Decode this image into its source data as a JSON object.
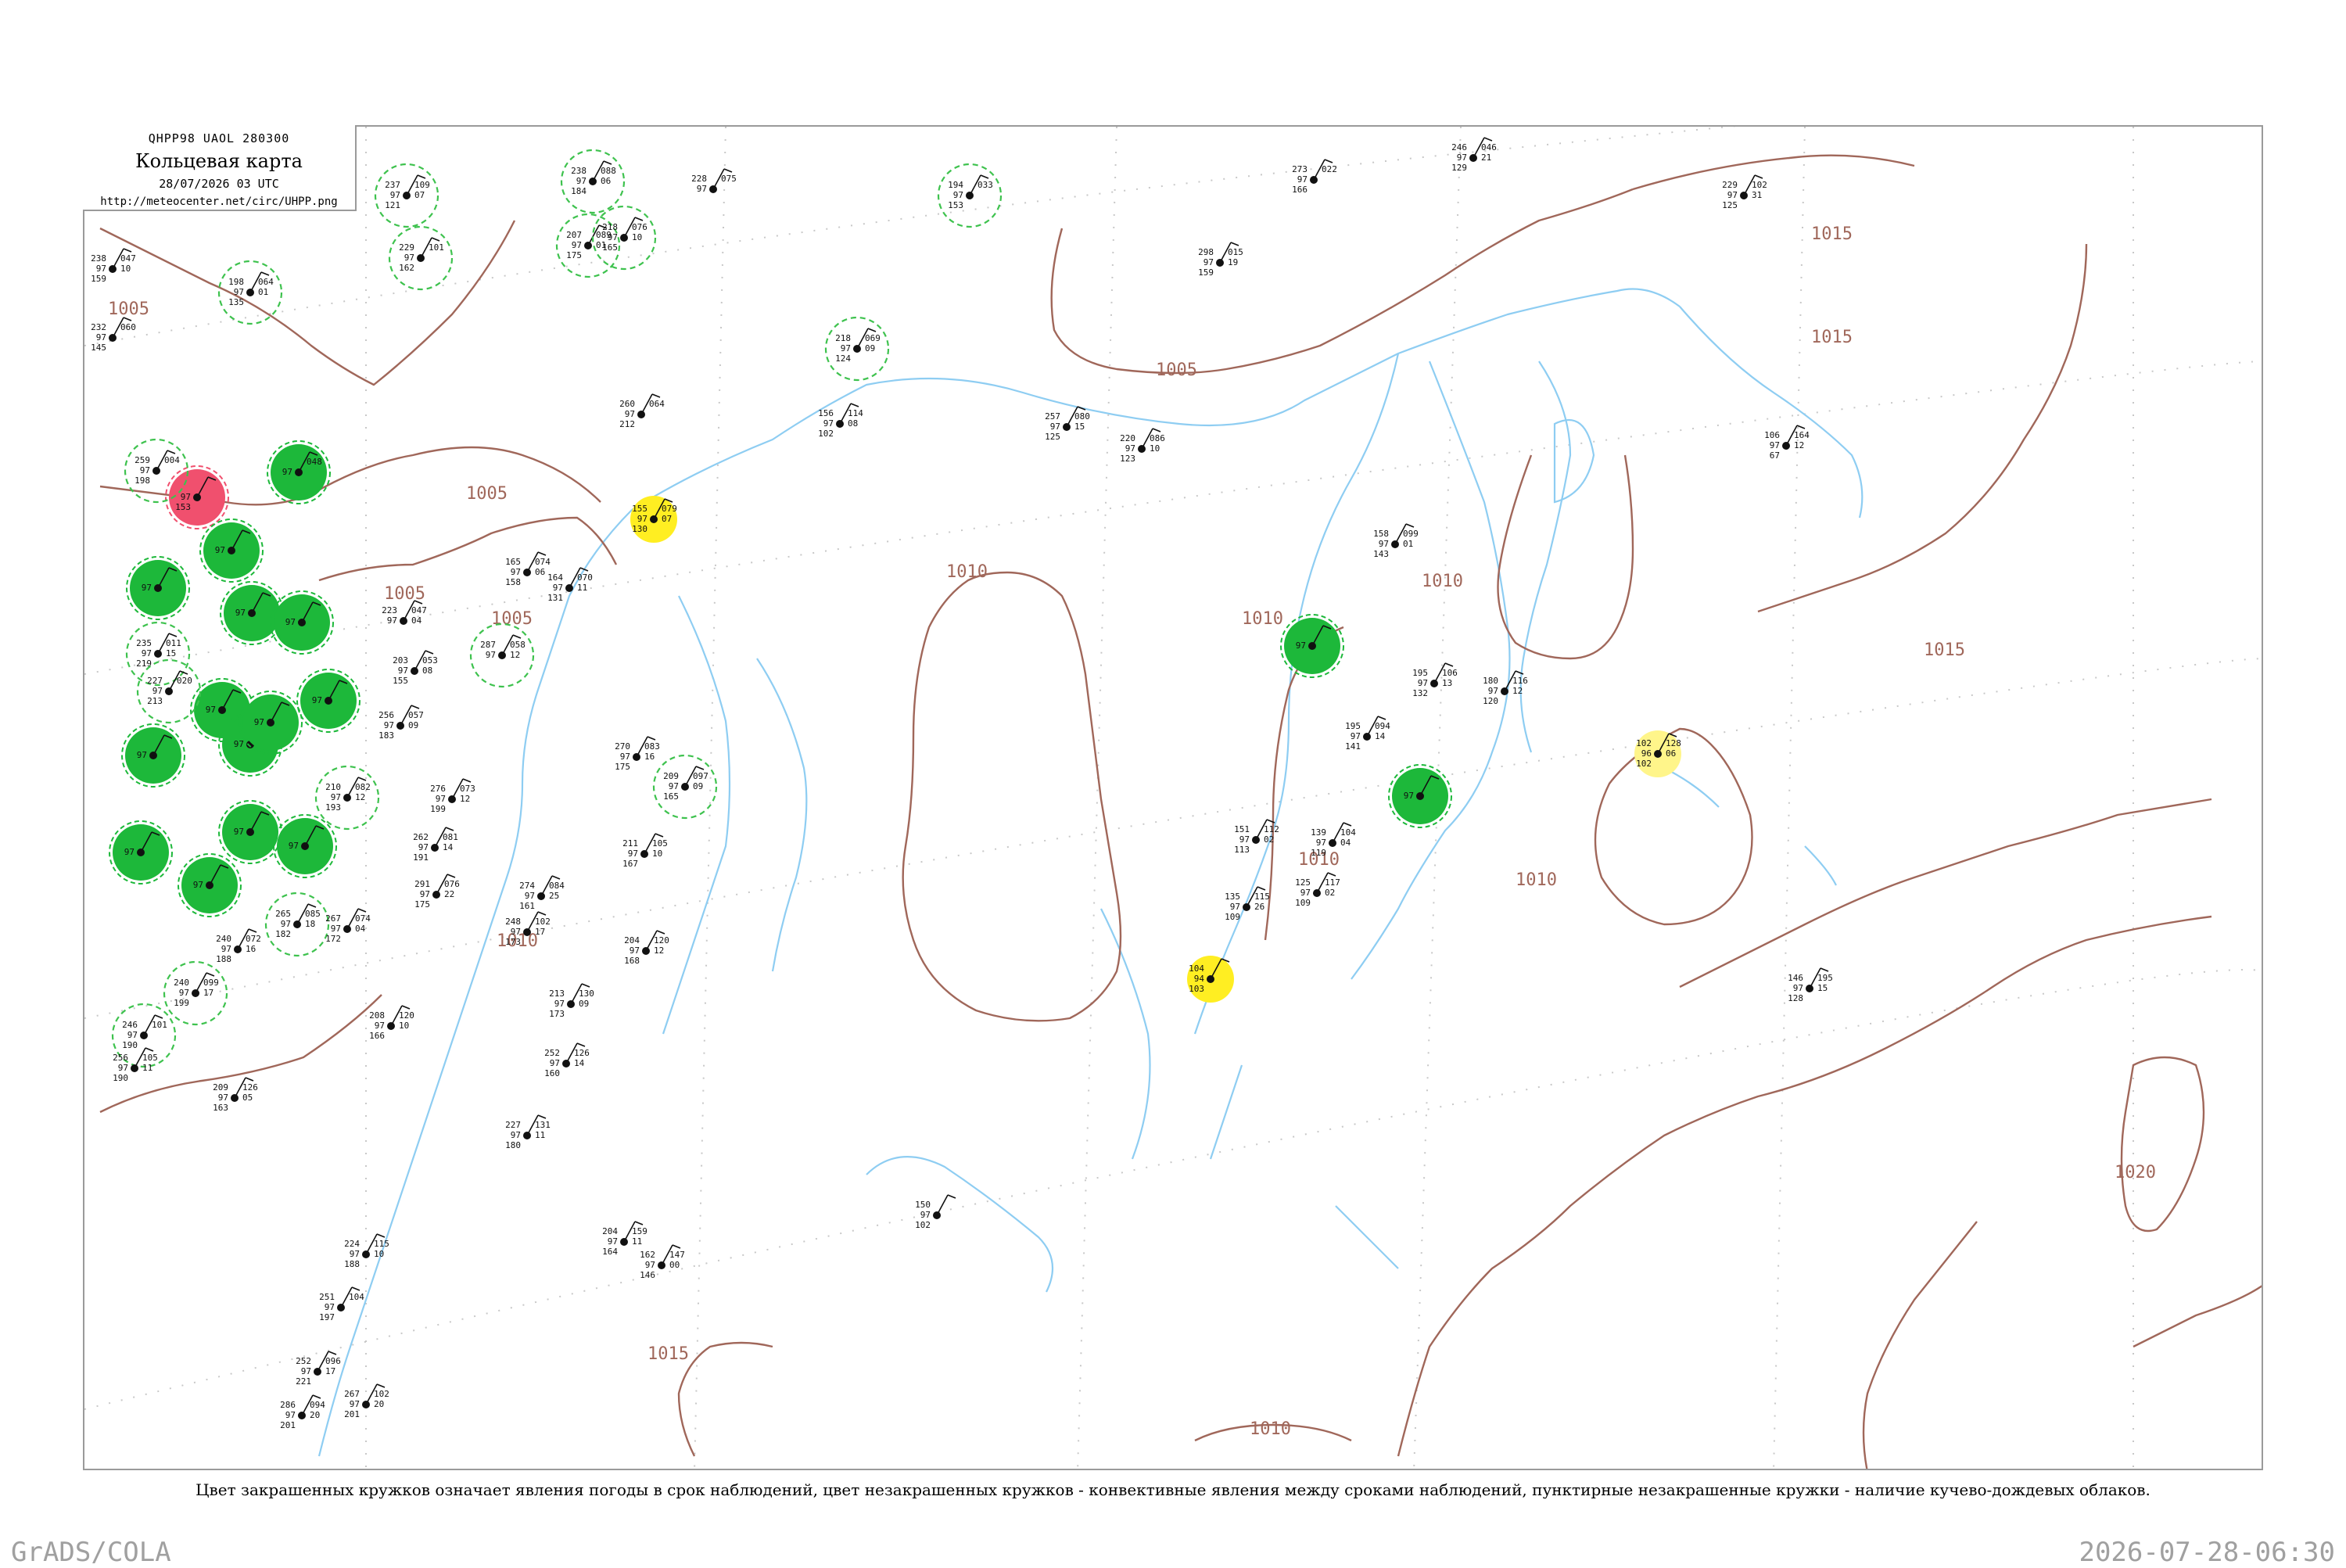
{
  "header": {
    "code": "QHPP98 UAOL 280300",
    "title": "Кольцевая карта",
    "date": "28/07/2026 03 UTC",
    "url": "http://meteocenter.net/circ/UHPP.png"
  },
  "legend": "Цвет закрашенных кружков означает явления погоды в срок наблюдений, цвет незакрашенных кружков - конвективные явления между сроками наблюдений, пунктирные незакрашенные кружки - наличие кучево-дождевых облаков.",
  "footer": {
    "left": "GrADS/COLA",
    "right": "2026-07-28-06:30"
  },
  "colors": {
    "isobar": "#a0675a",
    "coast": "#8ecdf2",
    "green_fill": "#1db83a",
    "green_dash": "#3ec24e",
    "red_fill": "#f0506e",
    "yellow_fill": "#ffee22",
    "light_yellow_fill": "#fff58a",
    "grid": "#c8c8c8"
  },
  "isobars": [
    {
      "label": "1005"
    },
    {
      "label": "1005"
    },
    {
      "label": "1005"
    },
    {
      "label": "1005"
    },
    {
      "label": "1005"
    },
    {
      "label": "1010"
    },
    {
      "label": "1010"
    },
    {
      "label": "1010"
    },
    {
      "label": "1010"
    },
    {
      "label": "1010"
    },
    {
      "label": "1010"
    },
    {
      "label": "1010"
    },
    {
      "label": "1015"
    },
    {
      "label": "1015"
    },
    {
      "label": "1015"
    },
    {
      "label": "1015"
    },
    {
      "label": "1020"
    }
  ],
  "stations": [
    {
      "id": "s1",
      "marker": "red",
      "vals": [
        "",
        "97",
        "153"
      ],
      "right": [
        "",
        "",
        ""
      ]
    },
    {
      "id": "s2",
      "marker": "green",
      "vals": [
        "",
        "97",
        ""
      ],
      "right": [
        "048",
        "",
        ""
      ]
    },
    {
      "id": "s3",
      "marker": "green",
      "vals": [
        "",
        "97",
        ""
      ],
      "right": [
        "",
        "",
        ""
      ]
    },
    {
      "id": "s4",
      "marker": "green",
      "vals": [
        "",
        "97",
        ""
      ],
      "right": [
        "",
        "",
        ""
      ]
    },
    {
      "id": "s5",
      "marker": "green",
      "vals": [
        "",
        "97",
        ""
      ],
      "right": [
        "",
        "",
        ""
      ]
    },
    {
      "id": "s6",
      "marker": "green",
      "vals": [
        "",
        "97",
        ""
      ],
      "right": [
        "",
        "",
        ""
      ]
    },
    {
      "id": "s7",
      "marker": "green",
      "vals": [
        "",
        "97",
        ""
      ],
      "right": [
        "",
        "",
        ""
      ]
    },
    {
      "id": "s8",
      "marker": "green",
      "vals": [
        "",
        "97",
        ""
      ],
      "right": [
        "",
        "",
        ""
      ]
    },
    {
      "id": "s9",
      "marker": "green",
      "vals": [
        "",
        "97",
        ""
      ],
      "right": [
        "",
        "",
        ""
      ]
    },
    {
      "id": "s10",
      "marker": "green",
      "vals": [
        "",
        "97",
        ""
      ],
      "right": [
        "",
        "",
        ""
      ]
    },
    {
      "id": "s11",
      "marker": "green",
      "vals": [
        "",
        "97",
        ""
      ],
      "right": [
        "",
        "",
        ""
      ]
    },
    {
      "id": "s12",
      "marker": "green",
      "vals": [
        "",
        "97",
        ""
      ],
      "right": [
        "",
        "",
        ""
      ]
    },
    {
      "id": "s13",
      "marker": "green",
      "vals": [
        "",
        "97",
        ""
      ],
      "right": [
        "",
        "",
        ""
      ]
    },
    {
      "id": "s14",
      "marker": "green",
      "vals": [
        "",
        "97",
        ""
      ],
      "right": [
        "",
        "",
        ""
      ]
    },
    {
      "id": "s15",
      "marker": "green",
      "vals": [
        "",
        "97",
        ""
      ],
      "right": [
        "",
        "",
        ""
      ]
    },
    {
      "id": "s16",
      "marker": "green",
      "vals": [
        "",
        "97",
        ""
      ],
      "right": [
        "",
        "",
        ""
      ]
    },
    {
      "id": "s17",
      "marker": "green",
      "vals": [
        "",
        "97",
        ""
      ],
      "right": [
        "",
        "",
        ""
      ]
    },
    {
      "id": "s18",
      "marker": "yellow",
      "vals": [
        "155",
        "97",
        "130"
      ],
      "right": [
        "079",
        "07",
        ""
      ]
    },
    {
      "id": "s19",
      "marker": "yellow",
      "vals": [
        "104",
        "94",
        "103"
      ],
      "right": [
        "",
        "",
        ""
      ]
    },
    {
      "id": "s20",
      "marker": "light_yellow",
      "vals": [
        "102",
        "96",
        "102"
      ],
      "right": [
        "128",
        "06",
        ""
      ]
    },
    {
      "id": "s21",
      "marker": "green-dash",
      "vals": [
        "237",
        "97",
        "121"
      ],
      "right": [
        "109",
        "07",
        ""
      ]
    },
    {
      "id": "s22",
      "marker": "green-dash",
      "vals": [
        "229",
        "97",
        "162"
      ],
      "right": [
        "101",
        "",
        ""
      ]
    },
    {
      "id": "s23",
      "marker": "green-dash",
      "vals": [
        "238",
        "97",
        "184"
      ],
      "right": [
        "088",
        "06",
        ""
      ]
    },
    {
      "id": "s24",
      "marker": "green-dash",
      "vals": [
        "207",
        "97",
        "175"
      ],
      "right": [
        "089",
        "01",
        ""
      ]
    },
    {
      "id": "s25",
      "marker": "green-dash",
      "vals": [
        "218",
        "97",
        "165"
      ],
      "right": [
        "076",
        "10",
        ""
      ]
    },
    {
      "id": "s26",
      "marker": "green-dash",
      "vals": [
        "198",
        "97",
        "135"
      ],
      "right": [
        "064",
        "01",
        ""
      ]
    },
    {
      "id": "s27",
      "marker": "green-dash",
      "vals": [
        "194",
        "97",
        "153"
      ],
      "right": [
        "033",
        "",
        ""
      ]
    },
    {
      "id": "s28",
      "marker": "green-dash",
      "vals": [
        "218",
        "97",
        "124"
      ],
      "right": [
        "069",
        "09",
        ""
      ]
    },
    {
      "id": "s29",
      "marker": "green-dash",
      "vals": [
        "259",
        "97",
        "198"
      ],
      "right": [
        "004",
        "",
        ""
      ]
    },
    {
      "id": "s30",
      "marker": "green-dash",
      "vals": [
        "235",
        "97",
        "219"
      ],
      "right": [
        "011",
        "15",
        ""
      ]
    },
    {
      "id": "s31",
      "marker": "green-dash",
      "vals": [
        "227",
        "97",
        "213"
      ],
      "right": [
        "020",
        "",
        ""
      ]
    },
    {
      "id": "s32",
      "marker": "green-dash",
      "vals": [
        "210",
        "97",
        "193"
      ],
      "right": [
        "082",
        "12",
        ""
      ]
    },
    {
      "id": "s33",
      "marker": "green-dash",
      "vals": [
        "209",
        "97",
        "165"
      ],
      "right": [
        "097",
        "09",
        ""
      ]
    },
    {
      "id": "s34",
      "marker": "green-dash",
      "vals": [
        "265",
        "97",
        "182"
      ],
      "right": [
        "085",
        "18",
        ""
      ]
    },
    {
      "id": "s35",
      "marker": "green-dash",
      "vals": [
        "240",
        "97",
        "199"
      ],
      "right": [
        "099",
        "17",
        ""
      ]
    },
    {
      "id": "s36",
      "marker": "green-dash",
      "vals": [
        "287",
        "97",
        ""
      ],
      "right": [
        "058",
        "12",
        ""
      ]
    },
    {
      "id": "s37",
      "marker": "green-dash",
      "vals": [
        "246",
        "97",
        "190"
      ],
      "right": [
        "101",
        "",
        ""
      ]
    },
    {
      "id": "s38",
      "marker": "dot",
      "vals": [
        "228",
        "97",
        ""
      ],
      "right": [
        "075",
        "",
        ""
      ]
    },
    {
      "id": "s39",
      "marker": "dot",
      "vals": [
        "273",
        "97",
        "166"
      ],
      "right": [
        "022",
        "",
        ""
      ]
    },
    {
      "id": "s40",
      "marker": "dot",
      "vals": [
        "246",
        "97",
        "129"
      ],
      "right": [
        "046",
        "21",
        ""
      ]
    },
    {
      "id": "s41",
      "marker": "dot",
      "vals": [
        "229",
        "97",
        "125"
      ],
      "right": [
        "102",
        "31",
        ""
      ]
    },
    {
      "id": "s42",
      "marker": "dot",
      "vals": [
        "298",
        "97",
        "159"
      ],
      "right": [
        "015",
        "19",
        ""
      ]
    },
    {
      "id": "s43",
      "marker": "dot",
      "vals": [
        "260",
        "97",
        "212"
      ],
      "right": [
        "064",
        "",
        ""
      ]
    },
    {
      "id": "s44",
      "marker": "dot",
      "vals": [
        "156",
        "97",
        "102"
      ],
      "right": [
        "114",
        "08",
        ""
      ]
    },
    {
      "id": "s45",
      "marker": "dot",
      "vals": [
        "257",
        "97",
        "125"
      ],
      "right": [
        "080",
        "15",
        ""
      ]
    },
    {
      "id": "s46",
      "marker": "dot",
      "vals": [
        "220",
        "97",
        "123"
      ],
      "right": [
        "086",
        "10",
        ""
      ]
    },
    {
      "id": "s47",
      "marker": "dot",
      "vals": [
        "106",
        "97",
        "67"
      ],
      "right": [
        "164",
        "12",
        ""
      ]
    },
    {
      "id": "s48",
      "marker": "dot",
      "vals": [
        "158",
        "97",
        "143"
      ],
      "right": [
        "099",
        "01",
        ""
      ]
    },
    {
      "id": "s49",
      "marker": "dot",
      "vals": [
        "195",
        "97",
        "132"
      ],
      "right": [
        "106",
        "13",
        ""
      ]
    },
    {
      "id": "s50",
      "marker": "dot",
      "vals": [
        "180",
        "97",
        "120"
      ],
      "right": [
        "116",
        "12",
        ""
      ]
    },
    {
      "id": "s51",
      "marker": "dot",
      "vals": [
        "195",
        "97",
        "141"
      ],
      "right": [
        "094",
        "14",
        ""
      ]
    },
    {
      "id": "s52",
      "marker": "dot",
      "vals": [
        "151",
        "97",
        "113"
      ],
      "right": [
        "112",
        "02",
        ""
      ]
    },
    {
      "id": "s53",
      "marker": "dot",
      "vals": [
        "139",
        "97",
        "119"
      ],
      "right": [
        "104",
        "04",
        ""
      ]
    },
    {
      "id": "s54",
      "marker": "dot",
      "vals": [
        "135",
        "97",
        "109"
      ],
      "right": [
        "115",
        "26",
        ""
      ]
    },
    {
      "id": "s55",
      "marker": "dot",
      "vals": [
        "125",
        "97",
        "109"
      ],
      "right": [
        "117",
        "02",
        ""
      ]
    },
    {
      "id": "s56",
      "marker": "dot",
      "vals": [
        "146",
        "97",
        "128"
      ],
      "right": [
        "195",
        "15",
        ""
      ]
    },
    {
      "id": "s57",
      "marker": "dot",
      "vals": [
        "165",
        "97",
        "158"
      ],
      "right": [
        "074",
        "06",
        ""
      ]
    },
    {
      "id": "s58",
      "marker": "dot",
      "vals": [
        "164",
        "97",
        "131"
      ],
      "right": [
        "070",
        "11",
        ""
      ]
    },
    {
      "id": "s59",
      "marker": "dot",
      "vals": [
        "223",
        "97",
        ""
      ],
      "right": [
        "047",
        "04",
        ""
      ]
    },
    {
      "id": "s60",
      "marker": "dot",
      "vals": [
        "203",
        "97",
        "155"
      ],
      "right": [
        "053",
        "08",
        ""
      ]
    },
    {
      "id": "s61",
      "marker": "dot",
      "vals": [
        "256",
        "97",
        "183"
      ],
      "right": [
        "057",
        "09",
        ""
      ]
    },
    {
      "id": "s62",
      "marker": "dot",
      "vals": [
        "276",
        "97",
        "199"
      ],
      "right": [
        "073",
        "12",
        ""
      ]
    },
    {
      "id": "s63",
      "marker": "dot",
      "vals": [
        "262",
        "97",
        "191"
      ],
      "right": [
        "081",
        "14",
        ""
      ]
    },
    {
      "id": "s64",
      "marker": "dot",
      "vals": [
        "291",
        "97",
        "175"
      ],
      "right": [
        "076",
        "22",
        ""
      ]
    },
    {
      "id": "s65",
      "marker": "dot",
      "vals": [
        "270",
        "97",
        "175"
      ],
      "right": [
        "083",
        "16",
        ""
      ]
    },
    {
      "id": "s66",
      "marker": "dot",
      "vals": [
        "211",
        "97",
        "167"
      ],
      "right": [
        "105",
        "10",
        ""
      ]
    },
    {
      "id": "s67",
      "marker": "dot",
      "vals": [
        "274",
        "97",
        "161"
      ],
      "right": [
        "084",
        "25",
        ""
      ]
    },
    {
      "id": "s68",
      "marker": "dot",
      "vals": [
        "248",
        "97",
        "173"
      ],
      "right": [
        "102",
        "17",
        ""
      ]
    },
    {
      "id": "s69",
      "marker": "dot",
      "vals": [
        "204",
        "97",
        "168"
      ],
      "right": [
        "120",
        "12",
        ""
      ]
    },
    {
      "id": "s70",
      "marker": "dot",
      "vals": [
        "213",
        "97",
        "173"
      ],
      "right": [
        "130",
        "09",
        ""
      ]
    },
    {
      "id": "s71",
      "marker": "dot",
      "vals": [
        "252",
        "97",
        "160"
      ],
      "right": [
        "126",
        "14",
        ""
      ]
    },
    {
      "id": "s72",
      "marker": "dot",
      "vals": [
        "208",
        "97",
        "166"
      ],
      "right": [
        "120",
        "10",
        ""
      ]
    },
    {
      "id": "s73",
      "marker": "dot",
      "vals": [
        "267",
        "97",
        "172"
      ],
      "right": [
        "074",
        "04",
        ""
      ]
    },
    {
      "id": "s74",
      "marker": "dot",
      "vals": [
        "240",
        "97",
        "188"
      ],
      "right": [
        "072",
        "16",
        ""
      ]
    },
    {
      "id": "s75",
      "marker": "dot",
      "vals": [
        "209",
        "97",
        "163"
      ],
      "right": [
        "126",
        "05",
        ""
      ]
    },
    {
      "id": "s76",
      "marker": "dot",
      "vals": [
        "256",
        "97",
        "190"
      ],
      "right": [
        "105",
        "11",
        ""
      ]
    },
    {
      "id": "s77",
      "marker": "dot",
      "vals": [
        "227",
        "97",
        "180"
      ],
      "right": [
        "131",
        "11",
        ""
      ]
    },
    {
      "id": "s78",
      "marker": "dot",
      "vals": [
        "204",
        "97",
        "164"
      ],
      "right": [
        "159",
        "11",
        ""
      ]
    },
    {
      "id": "s79",
      "marker": "dot",
      "vals": [
        "162",
        "97",
        "146"
      ],
      "right": [
        "147",
        "00",
        ""
      ]
    },
    {
      "id": "s80",
      "marker": "dot",
      "vals": [
        "150",
        "97",
        "102"
      ],
      "right": [
        "",
        "",
        ""
      ]
    },
    {
      "id": "s81",
      "marker": "dot",
      "vals": [
        "224",
        "97",
        "188"
      ],
      "right": [
        "115",
        "10",
        ""
      ]
    },
    {
      "id": "s82",
      "marker": "dot",
      "vals": [
        "251",
        "97",
        "197"
      ],
      "right": [
        "104",
        "",
        ""
      ]
    },
    {
      "id": "s83",
      "marker": "dot",
      "vals": [
        "252",
        "97",
        "221"
      ],
      "right": [
        "096",
        "17",
        ""
      ]
    },
    {
      "id": "s84",
      "marker": "dot",
      "vals": [
        "286",
        "97",
        "201"
      ],
      "right": [
        "094",
        "20",
        ""
      ]
    },
    {
      "id": "s85",
      "marker": "dot",
      "vals": [
        "267",
        "97",
        "201"
      ],
      "right": [
        "102",
        "20",
        ""
      ]
    },
    {
      "id": "s86",
      "marker": "dot",
      "vals": [
        "232",
        "97",
        "145"
      ],
      "right": [
        "060",
        "",
        ""
      ]
    },
    {
      "id": "s87",
      "marker": "dot",
      "vals": [
        "238",
        "97",
        "159"
      ],
      "right": [
        "047",
        "10",
        ""
      ]
    }
  ]
}
